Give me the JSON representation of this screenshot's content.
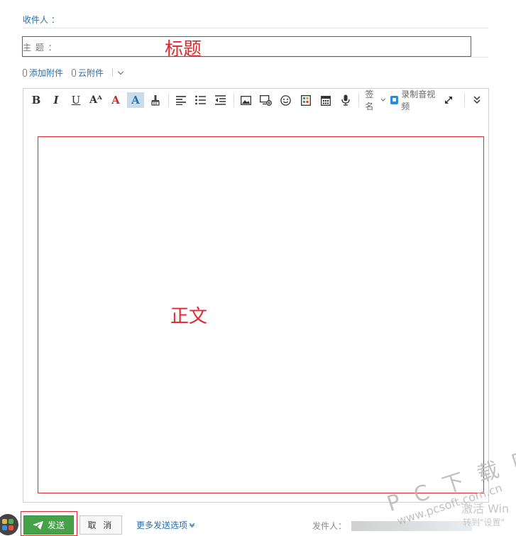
{
  "fields": {
    "to_label": "收件人 ：",
    "subject_label": "主  题 ："
  },
  "annotations": {
    "title": "标题",
    "body": "正文"
  },
  "attachments": {
    "add_attachment": "添加附件",
    "cloud_attachment": "云附件"
  },
  "toolbar": {
    "bold": "B",
    "italic": "I",
    "underline": "U",
    "font_size": "Aᴬ",
    "font_color": "A",
    "bg_color": "A",
    "signature": "签名",
    "record_av": "录制音视频",
    "icons": [
      "bold-icon",
      "italic-icon",
      "underline-icon",
      "font-size-icon",
      "font-color-icon",
      "highlight-icon",
      "format-painter-icon",
      "align-left-icon",
      "bulleted-list-icon",
      "outdent-icon",
      "image-icon",
      "screenshot-icon",
      "emoji-icon",
      "stationery-icon",
      "calendar-icon",
      "microphone-icon",
      "video-icon",
      "expand-icon",
      "more-icon"
    ]
  },
  "footer": {
    "send": "发送",
    "cancel": "取 消",
    "more_options": "更多发送选项",
    "sender_label": "发件人："
  },
  "watermark": {
    "brand": "P C 下 载 网",
    "url": "www.pcsoft.com.cn",
    "activate": "激活 Win",
    "activate_sub": "转到\"设置\""
  },
  "colors": {
    "accent": "#2a6ea8",
    "send": "#45a248",
    "annotation": "#e0282e",
    "font_color": "#c0302e"
  }
}
